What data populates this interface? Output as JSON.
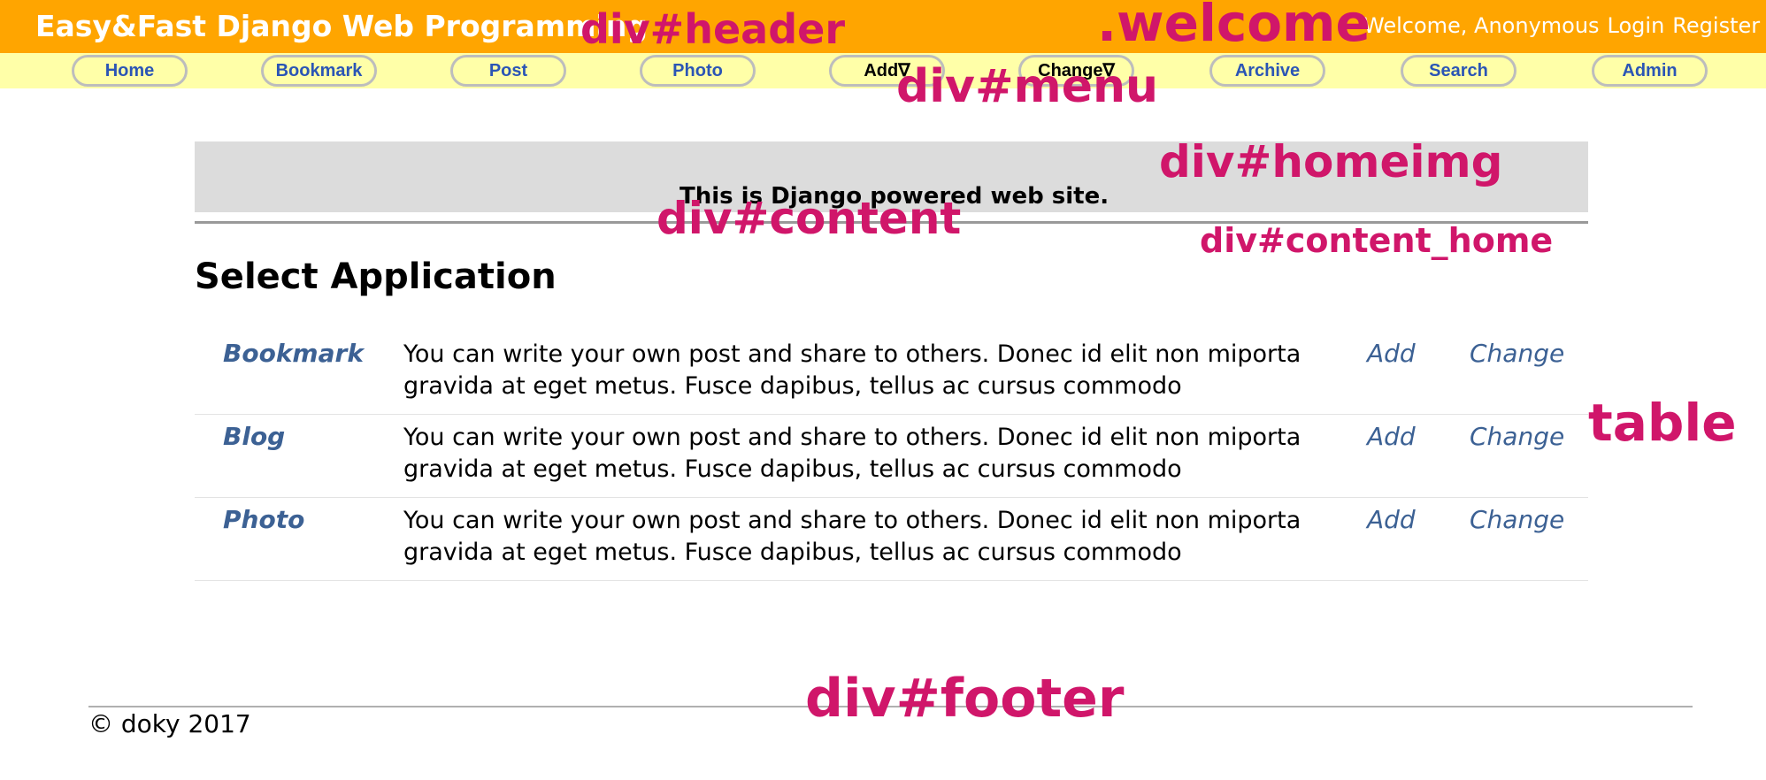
{
  "header": {
    "title": "Easy&Fast Django Web Programming",
    "welcome": "Welcome, Anonymous",
    "login": "Login",
    "register": "Register"
  },
  "menu": {
    "items": [
      "Home",
      "Bookmark",
      "Post",
      "Photo",
      "Add∇",
      "Change∇",
      "Archive",
      "Search",
      "Admin"
    ]
  },
  "banner": {
    "text": "This is Django powered web site."
  },
  "section": {
    "title": "Select Application"
  },
  "apps": [
    {
      "name": "Bookmark",
      "description": "You can write your own post and share to others. Donec id elit non miporta gravida at eget metus. Fusce dapibus, tellus ac cursus commodo",
      "add": "Add",
      "change": "Change"
    },
    {
      "name": "Blog",
      "description": "You can write your own post and share to others. Donec id elit non miporta gravida at eget metus. Fusce dapibus, tellus ac cursus commodo",
      "add": "Add",
      "change": "Change"
    },
    {
      "name": "Photo",
      "description": "You can write your own post and share to others. Donec id elit non miporta gravida at eget metus. Fusce dapibus, tellus ac cursus commodo",
      "add": "Add",
      "change": "Change"
    }
  ],
  "footer": {
    "copyright": "© doky 2017"
  },
  "annotations": {
    "header": "div#header",
    "welcome": ".welcome",
    "menu": "div#menu",
    "homeimg": "div#homeimg",
    "content": "div#content",
    "content_home": "div#content_home",
    "table": "table",
    "footer": "div#footer"
  },
  "colors": {
    "header_bg": "#FFA500",
    "menu_bg": "#FFFFA8",
    "link": "#3c6194",
    "annotation": "#d0166a"
  }
}
